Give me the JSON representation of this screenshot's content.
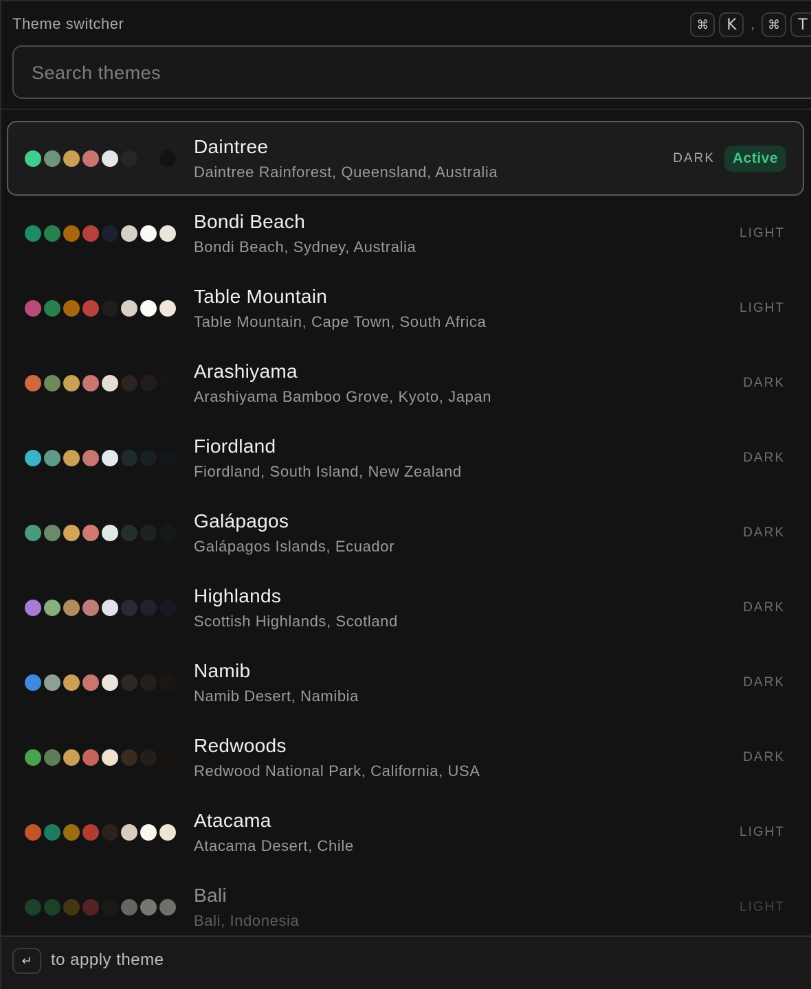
{
  "header": {
    "title": "Theme switcher",
    "shortcut_1": [
      "⌘",
      "K"
    ],
    "separator": ",",
    "shortcut_2": [
      "⌘",
      "T"
    ]
  },
  "search": {
    "placeholder": "Search themes",
    "value": ""
  },
  "themes": [
    {
      "name": "Daintree",
      "location": "Daintree Rainforest, Queensland, Australia",
      "mode": "DARK",
      "active": true,
      "badge": "Active",
      "swatches": [
        "#3ecf8e",
        "#6e9479",
        "#c9a056",
        "#c97670",
        "#e6e6e6",
        "#262626",
        "#1c1c1c",
        "#121212"
      ]
    },
    {
      "name": "Bondi Beach",
      "location": "Bondi Beach, Sydney, Australia",
      "mode": "LIGHT",
      "active": false,
      "swatches": [
        "#1f8a68",
        "#2a7f4f",
        "#a8670e",
        "#b8413b",
        "#1a2230",
        "#d6d1c6",
        "#fbfaf6",
        "#ebe6da"
      ]
    },
    {
      "name": "Table Mountain",
      "location": "Table Mountain, Cape Town, South Africa",
      "mode": "LIGHT",
      "active": false,
      "swatches": [
        "#b84b7a",
        "#2a7f4f",
        "#a8670e",
        "#b8413b",
        "#201e1b",
        "#d8cfc6",
        "#fcfbf8",
        "#efe6dc"
      ]
    },
    {
      "name": "Arashiyama",
      "location": "Arashiyama Bamboo Grove, Kyoto, Japan",
      "mode": "DARK",
      "active": false,
      "swatches": [
        "#d0693f",
        "#6f8a5a",
        "#c9a056",
        "#c97670",
        "#e4ddd4",
        "#2b2420",
        "#221d1a",
        "#181412"
      ]
    },
    {
      "name": "Fiordland",
      "location": "Fiordland, South Island, New Zealand",
      "mode": "DARK",
      "active": false,
      "swatches": [
        "#3ab3c6",
        "#5f9a88",
        "#c9a056",
        "#c97670",
        "#e2eaec",
        "#1f2a2c",
        "#172123",
        "#10181a"
      ]
    },
    {
      "name": "Galápagos",
      "location": "Galápagos Islands, Ecuador",
      "mode": "DARK",
      "active": false,
      "swatches": [
        "#4a9a7c",
        "#6b8a6c",
        "#d3a45a",
        "#d27a72",
        "#dfe8e3",
        "#233129",
        "#1b241f",
        "#141a17"
      ]
    },
    {
      "name": "Highlands",
      "location": "Scottish Highlands, Scotland",
      "mode": "DARK",
      "active": false,
      "swatches": [
        "#a97ad6",
        "#86b07d",
        "#b18c5c",
        "#c07d78",
        "#e2e2ea",
        "#2b2934",
        "#222029",
        "#19181e"
      ]
    },
    {
      "name": "Namib",
      "location": "Namib Desert, Namibia",
      "mode": "DARK",
      "active": false,
      "swatches": [
        "#3f8ae0",
        "#8fa094",
        "#c9a056",
        "#c97670",
        "#ece5dc",
        "#2e2822",
        "#241f1b",
        "#1a1613"
      ]
    },
    {
      "name": "Redwoods",
      "location": "Redwood National Park, California, USA",
      "mode": "DARK",
      "active": false,
      "swatches": [
        "#4aa24f",
        "#5f7e58",
        "#c9a056",
        "#c46659",
        "#eee2cf",
        "#3a2a20",
        "#251d18",
        "#191310"
      ]
    },
    {
      "name": "Atacama",
      "location": "Atacama Desert, Chile",
      "mode": "LIGHT",
      "active": false,
      "swatches": [
        "#c4552a",
        "#1f7a64",
        "#9a6e12",
        "#b03c32",
        "#2a231d",
        "#d8cdbd",
        "#fbf7ef",
        "#efe5d2"
      ]
    },
    {
      "name": "Bali",
      "location": "Bali, Indonesia",
      "mode": "LIGHT",
      "active": false,
      "faded": true,
      "swatches": [
        "#1f6a3a",
        "#1f6a3a",
        "#6e5312",
        "#8a2f2f",
        "#1d211d",
        "#a9aaa2",
        "#c9c9c1",
        "#bdbdb4"
      ]
    }
  ],
  "footer": {
    "key": "↵",
    "hint": "to apply theme"
  }
}
